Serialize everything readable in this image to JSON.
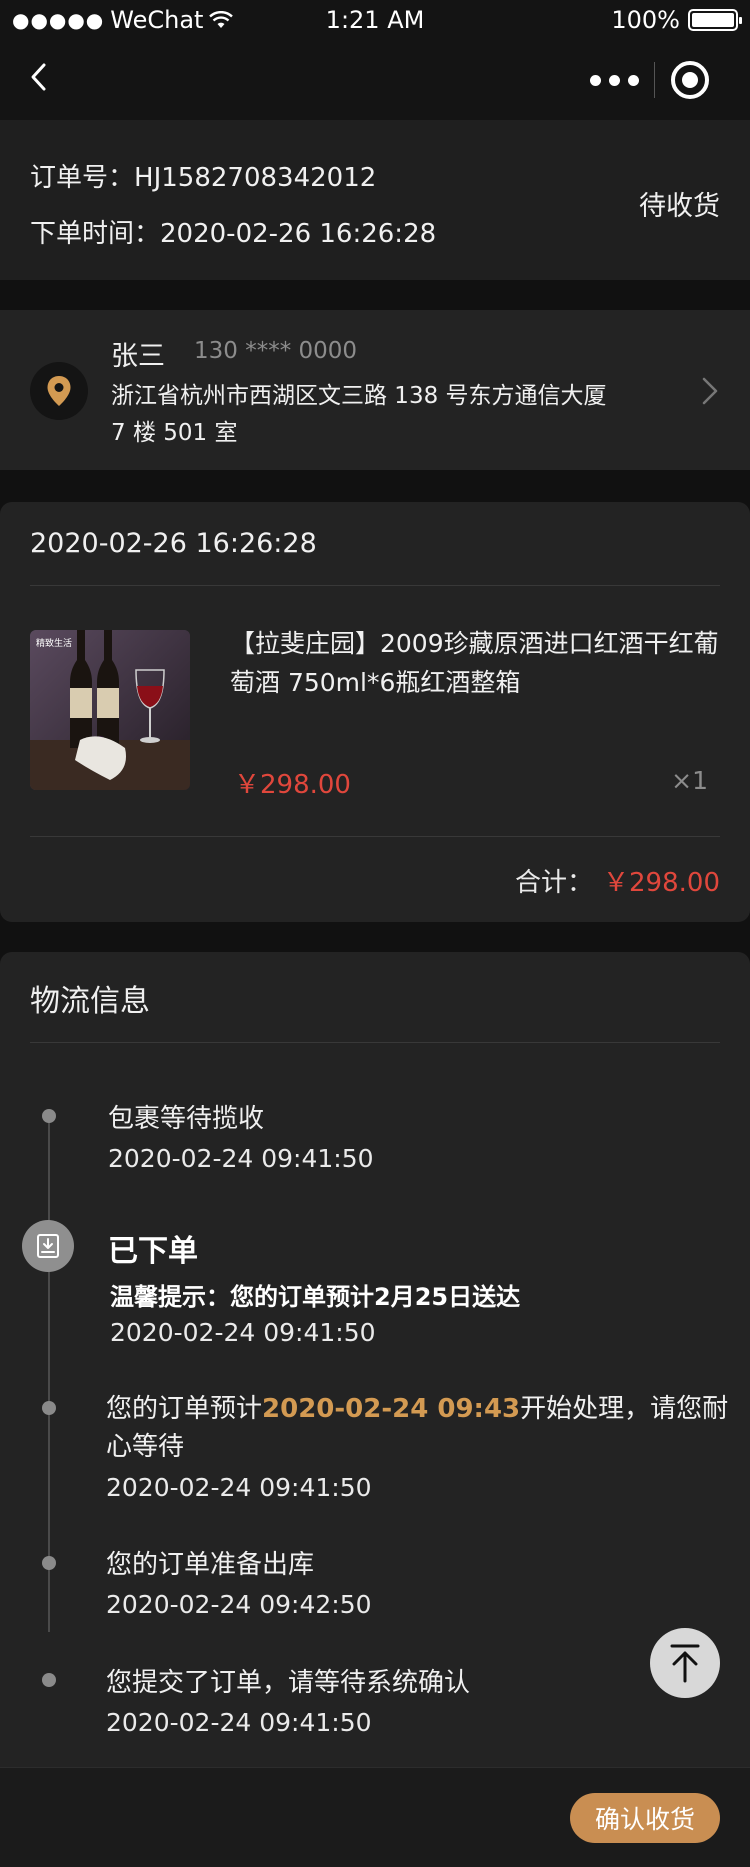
{
  "status_bar": {
    "signal": "●●●●●",
    "carrier": "WeChat",
    "time": "1:21 AM",
    "battery": "100%"
  },
  "nav": {
    "back_icon": "chevron-left-icon",
    "more_icon": "more-dots-icon",
    "close_icon": "record-circle-icon"
  },
  "order": {
    "number_label": "订单号：",
    "number": "HJ1582708342012",
    "time_label": "下单时间：",
    "time": "2020-02-26 16:26:28",
    "status": "待收货"
  },
  "address": {
    "name": "张三",
    "phone": "130 **** 0000",
    "detail": "浙江省杭州市西湖区文三路 138 号东方通信大厦 7 楼 501 室",
    "icon": "location-pin-icon",
    "icon_color": "#d39a52"
  },
  "product": {
    "date": "2020-02-26 16:26:28",
    "title": "【拉斐庄园】2009珍藏原酒进口红酒干红葡萄酒 750ml*6瓶红酒整箱",
    "price": "￥298.00",
    "qty": "×1",
    "thumb_text": "精致生活",
    "total_label": "合计：",
    "total": "￥298.00"
  },
  "logistics": {
    "title": "物流信息",
    "events": [
      {
        "text": "包裹等待揽收",
        "time": "2020-02-24    09:41:50"
      },
      {
        "text": "已下单",
        "tip": "温馨提示：您的订单预计2月25日送达",
        "time": "2020-02-24    09:41:50"
      },
      {
        "text_before": "您的订单预计",
        "highlight": "2020-02-24 09:43",
        "text_after": "开始处理，请您耐",
        "text_line2": "心等待",
        "time": "2020-02-24    09:41:50"
      },
      {
        "text": "您的订单准备出库",
        "time": "2020-02-24    09:42:50"
      },
      {
        "text": "您提交了订单，请等待系统确认",
        "time": "2020-02-24    09:41:50"
      }
    ]
  },
  "footer": {
    "confirm_label": "确认收货"
  },
  "colors": {
    "accent": "#c98e52",
    "price": "#e0473c",
    "highlight": "#d39a52"
  }
}
